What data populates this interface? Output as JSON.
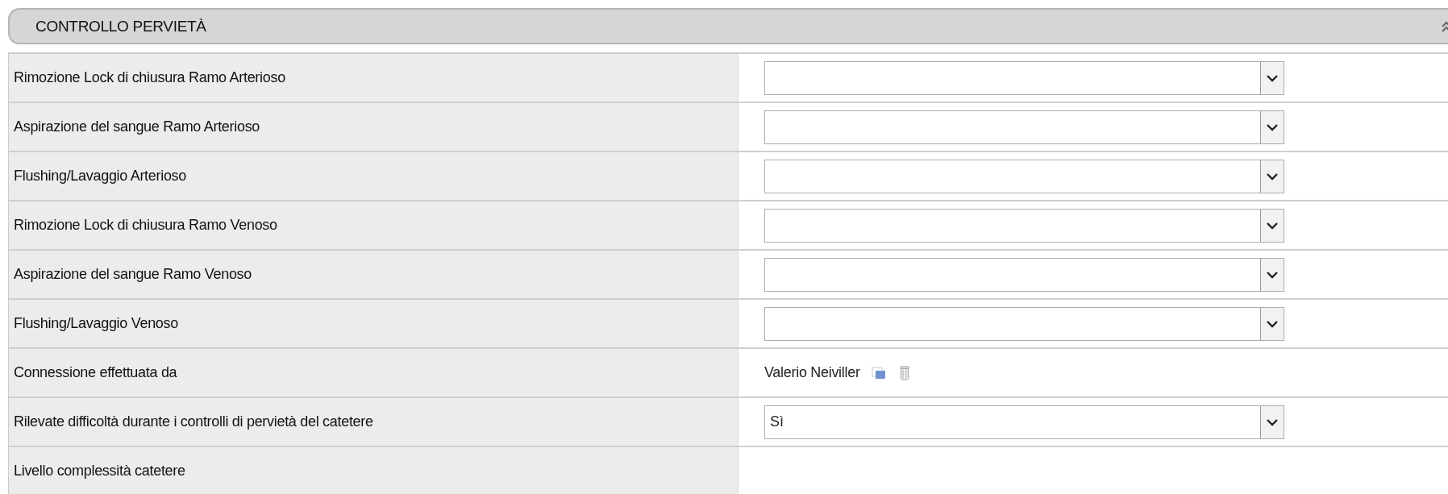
{
  "section": {
    "title": "CONTROLLO PERVIETÀ",
    "expanded": true
  },
  "fields": [
    {
      "label": "Rimozione Lock di chiusura Ramo Arterioso",
      "kind": "select"
    },
    {
      "label": "Aspirazione del sangue Ramo Arterioso",
      "kind": "select"
    },
    {
      "label": "Flushing/Lavaggio Arterioso",
      "kind": "select"
    },
    {
      "label": "Rimozione Lock di chiusura Ramo Venoso",
      "kind": "select"
    },
    {
      "label": "Aspirazione del sangue Ramo Venoso",
      "kind": "select"
    },
    {
      "label": "Flushing/Lavaggio Venoso",
      "kind": "select"
    },
    {
      "label": "Connessione effettuata da",
      "kind": "user",
      "value": "Valerio Neiviller"
    },
    {
      "label": "Rilevate difficoltà durante i controlli di pervietà del catetere",
      "kind": "select",
      "value": "Sì"
    },
    {
      "label": "Livello complessità catetere",
      "kind": "empty"
    }
  ]
}
